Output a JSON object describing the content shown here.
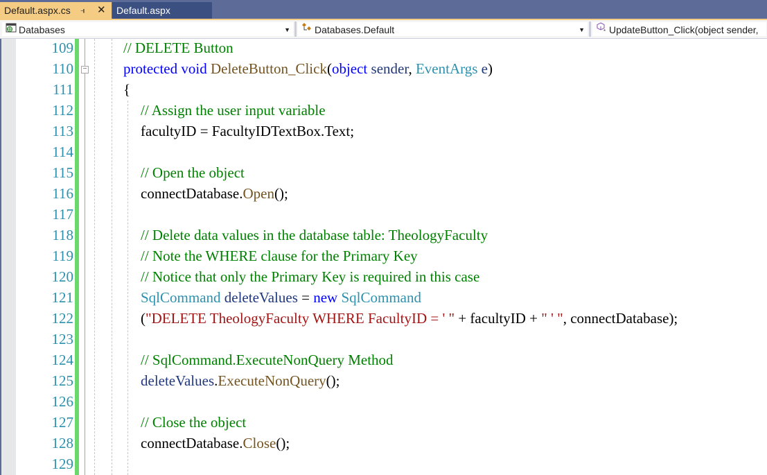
{
  "tabs": [
    {
      "label": "Default.aspx.cs",
      "active": true,
      "pin_icon": "pin-icon",
      "close_icon": "close-icon"
    },
    {
      "label": "Default.aspx",
      "active": false
    }
  ],
  "navigation": {
    "project": {
      "label": "Databases",
      "icon": "project-web-icon"
    },
    "type": {
      "label": "Databases.Default",
      "icon": "class-icon"
    },
    "member": {
      "label": "UpdateButton_Click(object sender,",
      "icon": "method-icon"
    }
  },
  "colors": {
    "keyword": "#0000ff",
    "comment": "#008000",
    "type": "#2b91af",
    "method": "#74531f",
    "variable": "#1f377f",
    "string": "#a31515",
    "line_number": "#2b91af",
    "change_bar": "#6bd86b",
    "active_tab": "#f5cc84",
    "tab_bar": "#5d6b99"
  },
  "editor": {
    "lines": [
      {
        "num": "109",
        "tokens": [
          [
            "cm",
            "// DELETE Button"
          ]
        ]
      },
      {
        "num": "110",
        "tokens": [
          [
            "kw",
            "protected"
          ],
          [
            "",
            " "
          ],
          [
            "kw",
            "void"
          ],
          [
            "",
            " "
          ],
          [
            "mt",
            "DeleteButton_Click"
          ],
          [
            "",
            "("
          ],
          [
            "kw",
            "object"
          ],
          [
            "",
            " "
          ],
          [
            "vr",
            "sender"
          ],
          [
            "",
            ", "
          ],
          [
            "ty",
            "EventArgs"
          ],
          [
            "",
            " "
          ],
          [
            "vr",
            "e"
          ],
          [
            "",
            ")"
          ]
        ]
      },
      {
        "num": "111",
        "tokens": [
          [
            "",
            "{"
          ]
        ]
      },
      {
        "num": "112",
        "tokens": [
          [
            "cm",
            "// Assign the user input variable"
          ]
        ]
      },
      {
        "num": "113",
        "tokens": [
          [
            "",
            "facultyID = FacultyIDTextBox.Text;"
          ]
        ]
      },
      {
        "num": "114",
        "tokens": []
      },
      {
        "num": "115",
        "tokens": [
          [
            "cm",
            "// Open the object"
          ]
        ]
      },
      {
        "num": "116",
        "tokens": [
          [
            "",
            "connectDatabase."
          ],
          [
            "mt",
            "Open"
          ],
          [
            "",
            "();"
          ]
        ]
      },
      {
        "num": "117",
        "tokens": []
      },
      {
        "num": "118",
        "tokens": [
          [
            "cm",
            "// Delete data values in the database table: TheologyFaculty"
          ]
        ]
      },
      {
        "num": "119",
        "tokens": [
          [
            "cm",
            "// Note the WHERE clause for the Primary Key"
          ]
        ]
      },
      {
        "num": "120",
        "tokens": [
          [
            "cm",
            "// Notice that only the Primary Key is required in this case"
          ]
        ]
      },
      {
        "num": "121",
        "tokens": [
          [
            "ty",
            "SqlCommand"
          ],
          [
            "",
            " "
          ],
          [
            "vr",
            "deleteValues"
          ],
          [
            "",
            " = "
          ],
          [
            "kw",
            "new"
          ],
          [
            "",
            " "
          ],
          [
            "ty",
            "SqlCommand"
          ]
        ]
      },
      {
        "num": "122",
        "tokens": [
          [
            "",
            "("
          ],
          [
            "st",
            "\"DELETE TheologyFaculty WHERE FacultyID = ' \""
          ],
          [
            "",
            " + facultyID + "
          ],
          [
            "st",
            "\" ' \""
          ],
          [
            "",
            ", connectDatabase);"
          ]
        ]
      },
      {
        "num": "123",
        "tokens": []
      },
      {
        "num": "124",
        "tokens": [
          [
            "cm",
            "// SqlCommand.ExecuteNonQuery Method"
          ]
        ]
      },
      {
        "num": "125",
        "tokens": [
          [
            "vr",
            "deleteValues"
          ],
          [
            "",
            "."
          ],
          [
            "mt",
            "ExecuteNonQuery"
          ],
          [
            "",
            "();"
          ]
        ]
      },
      {
        "num": "126",
        "tokens": []
      },
      {
        "num": "127",
        "tokens": [
          [
            "cm",
            "// Close the object"
          ]
        ]
      },
      {
        "num": "128",
        "tokens": [
          [
            "",
            "connectDatabase."
          ],
          [
            "mt",
            "Close"
          ],
          [
            "",
            "();"
          ]
        ]
      },
      {
        "num": "129",
        "tokens": []
      }
    ]
  }
}
